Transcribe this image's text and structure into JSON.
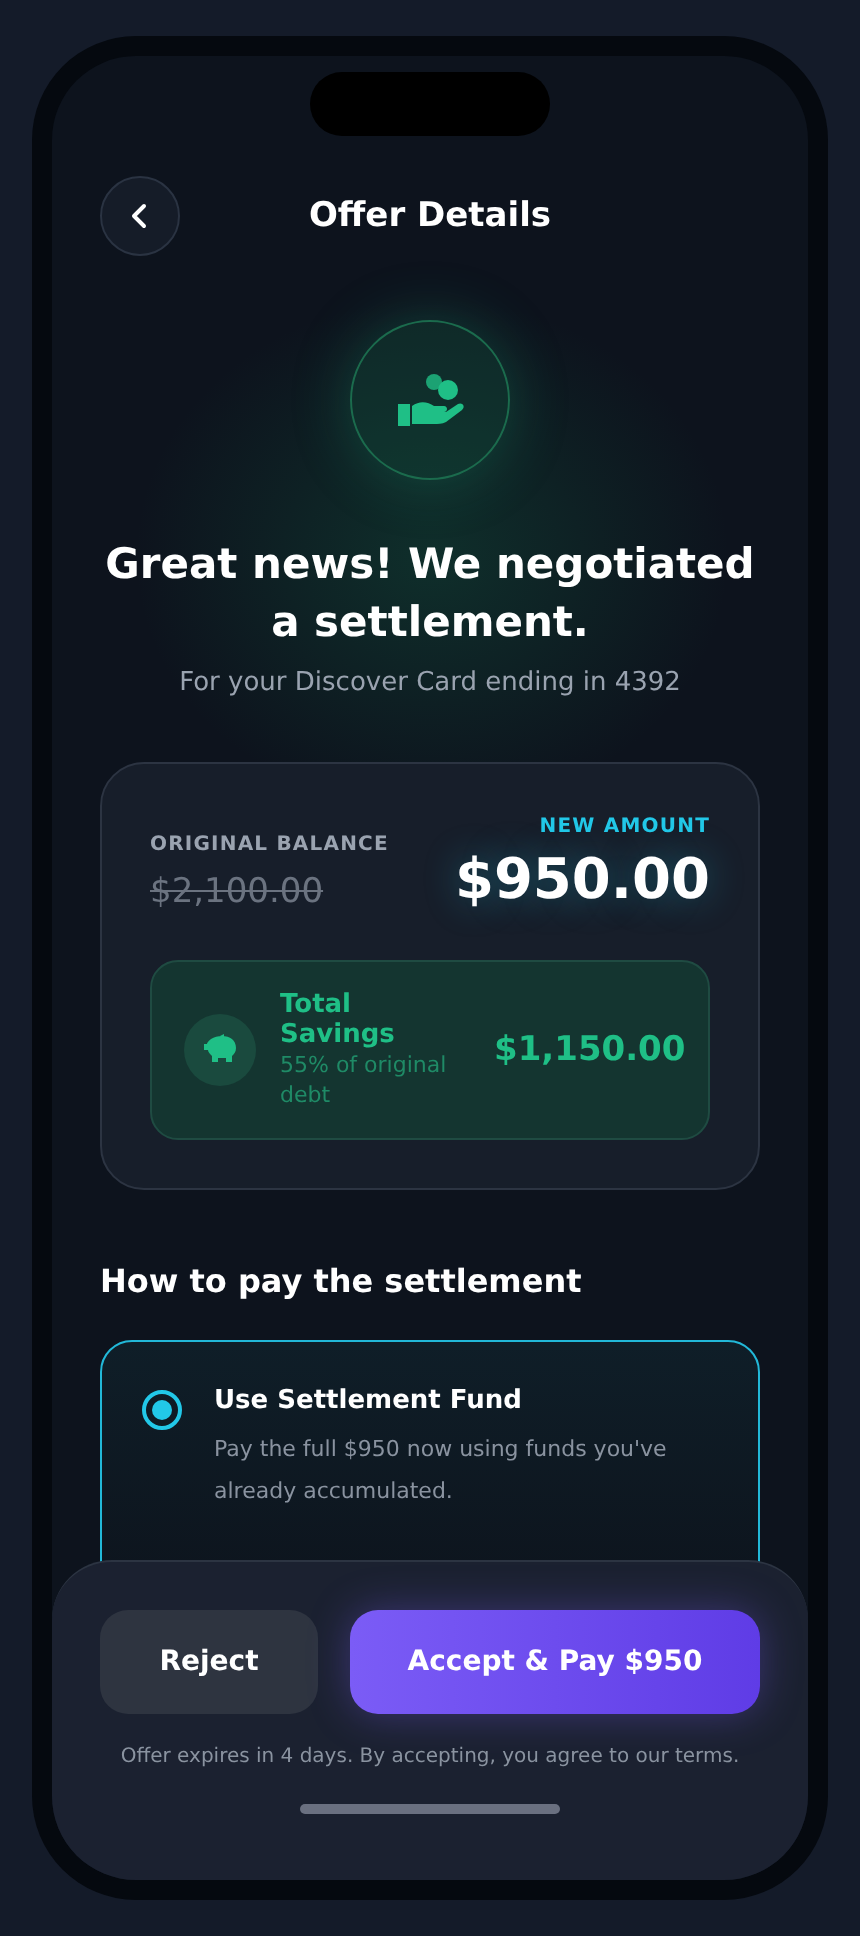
{
  "header": {
    "title": "Offer Details"
  },
  "hero": {
    "headline": "Great news! We negotiated a settlement.",
    "subtitle": "For your Discover Card ending in 4392"
  },
  "summary": {
    "original_label": "ORIGINAL BALANCE",
    "original_amount": "$2,100.00",
    "new_label": "NEW AMOUNT",
    "new_amount": "$950.00",
    "savings": {
      "title": "Total Savings",
      "detail": "55% of original debt",
      "amount": "$1,150.00"
    }
  },
  "payment": {
    "heading": "How to pay the settlement",
    "options": [
      {
        "title": "Use Settlement Fund",
        "description": "Pay the full $950 now using funds you've already accumulated.",
        "selected": true
      }
    ]
  },
  "actions": {
    "reject": "Reject",
    "accept": "Accept & Pay $950",
    "note": "Offer expires in 4 days. By accepting, you agree to our terms."
  }
}
